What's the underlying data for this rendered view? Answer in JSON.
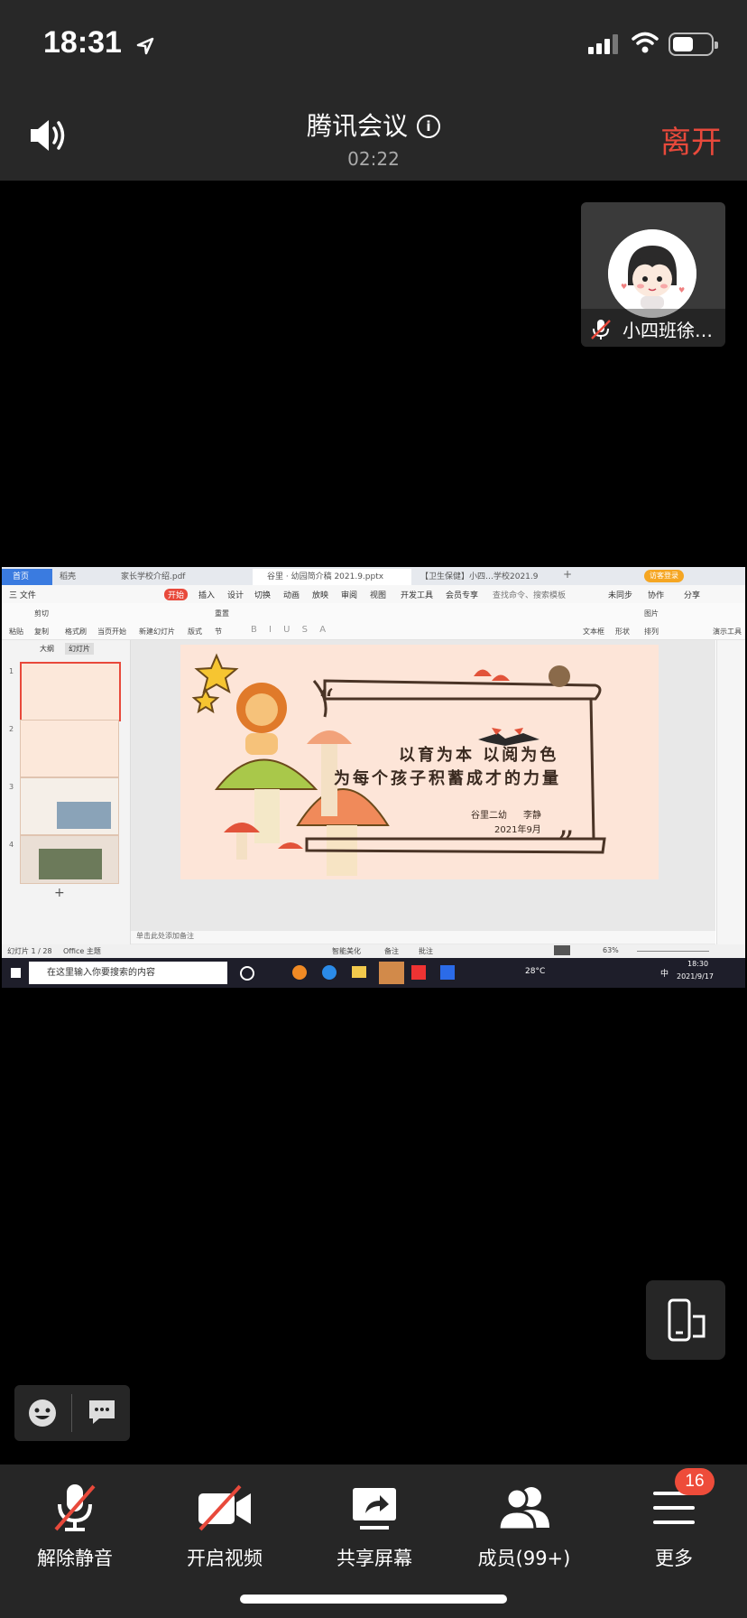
{
  "status_bar": {
    "time": "18:31",
    "battery_level": 0.55
  },
  "header": {
    "title": "腾讯会议",
    "elapsed": "02:22",
    "leave_label": "离开"
  },
  "participant": {
    "name": "小四班徐…"
  },
  "shared_screen": {
    "tabs": [
      "首页",
      "稻壳",
      "家长学校介绍.pdf",
      "谷里 · 幼园简介稿 2021.9.pptx",
      "【卫生保健】小四…学校2021.9"
    ],
    "user_badge": "访客登录",
    "menu": [
      "三 文件",
      "开始",
      "插入",
      "设计",
      "切换",
      "动画",
      "放映",
      "审阅",
      "视图",
      "开发工具",
      "会员专享",
      "查找命令、搜索模板",
      "未同步",
      "协作",
      "分享"
    ],
    "ribbon": [
      "粘贴",
      "剪切",
      "复制",
      "格式刷",
      "当页开始",
      "新建幻灯片",
      "版式",
      "节",
      "重置",
      "文本框",
      "形状",
      "图片",
      "排列",
      "演示工具"
    ],
    "panel_tabs": [
      "大纲",
      "幻灯片"
    ],
    "thumb_numbers": [
      "1",
      "2",
      "3",
      "4"
    ],
    "slide": {
      "line1": "以育为本  以阅为色",
      "line2": "为每个孩子积蓄成才的力量",
      "org": "谷里二幼",
      "author": "李静",
      "date": "2021年9月"
    },
    "notes_placeholder": "单击此处添加备注",
    "status_left": "幻灯片 1 / 28",
    "status_theme": "Office 主题",
    "status_beautify": "智能美化",
    "status_notes": "备注",
    "status_comments": "批注",
    "zoom": "63%",
    "taskbar_search": "在这里输入你要搜索的内容",
    "weather": "28°C",
    "tray_lang": "中",
    "clock_time": "18:30",
    "clock_date": "2021/9/17"
  },
  "toolbar": {
    "unmute": "解除静音",
    "video": "开启视频",
    "share": "共享屏幕",
    "members": "成员(99+)",
    "more": "更多",
    "more_badge": "16"
  },
  "colors": {
    "bar_bg": "#282828",
    "leave": "#e8493b",
    "badge": "#ee4c3a"
  }
}
